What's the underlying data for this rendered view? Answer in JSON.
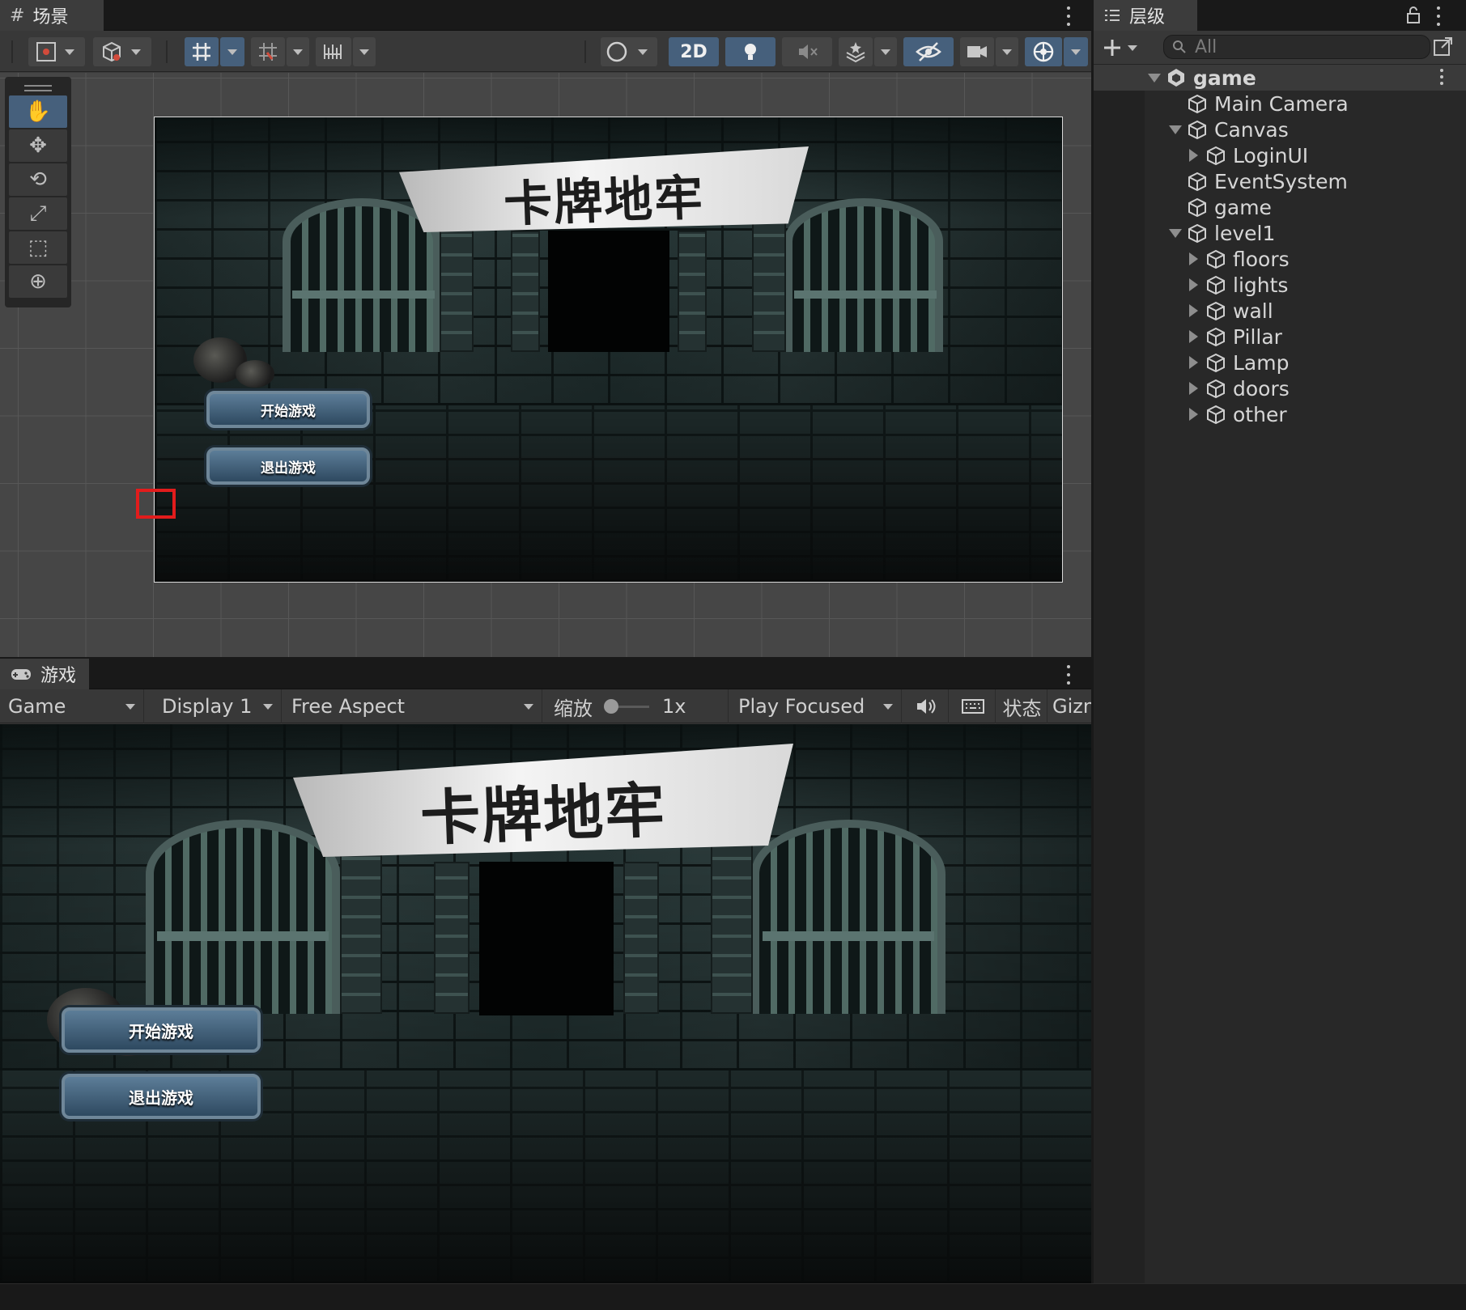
{
  "scene_panel": {
    "tab_label": "场景",
    "tab_icon": "hash-grid-icon",
    "toolbar": {
      "view_2d_label": "2D"
    },
    "tools": [
      "hand-tool-icon",
      "move-tool-icon",
      "rotate-tool-icon",
      "scale-tool-icon",
      "rect-tool-icon",
      "transform-tool-icon"
    ],
    "game_view": {
      "title": "卡牌地牢",
      "start_button": "开始游戏",
      "quit_button": "退出游戏"
    },
    "highlight_color": "#e21c1c"
  },
  "game_panel": {
    "tab_label": "游戏",
    "tab_icon": "gamepad-icon",
    "toolbar": {
      "target": "Game",
      "display": "Display 1",
      "aspect": "Free Aspect",
      "scale_label": "缩放",
      "scale_value": "1x",
      "play_mode": "Play Focused",
      "stats_label": "状态",
      "gizmos_label": "Gizn"
    },
    "game_view": {
      "title": "卡牌地牢",
      "start_button": "开始游戏",
      "quit_button": "退出游戏"
    }
  },
  "hierarchy": {
    "tab_label": "层级",
    "tab_icon": "list-icon",
    "search_placeholder": "All",
    "items": [
      {
        "label": "game",
        "depth": 0,
        "expander": "down",
        "root": true
      },
      {
        "label": "Main Camera",
        "depth": 1,
        "expander": "none"
      },
      {
        "label": "Canvas",
        "depth": 1,
        "expander": "down"
      },
      {
        "label": "LoginUI",
        "depth": 2,
        "expander": "right"
      },
      {
        "label": "EventSystem",
        "depth": 1,
        "expander": "none"
      },
      {
        "label": "game",
        "depth": 1,
        "expander": "none"
      },
      {
        "label": "level1",
        "depth": 1,
        "expander": "down"
      },
      {
        "label": "floors",
        "depth": 2,
        "expander": "right"
      },
      {
        "label": "lights",
        "depth": 2,
        "expander": "right"
      },
      {
        "label": "wall",
        "depth": 2,
        "expander": "right"
      },
      {
        "label": "Pillar",
        "depth": 2,
        "expander": "right"
      },
      {
        "label": "Lamp",
        "depth": 2,
        "expander": "right"
      },
      {
        "label": "doors",
        "depth": 2,
        "expander": "right"
      },
      {
        "label": "other",
        "depth": 2,
        "expander": "right"
      }
    ]
  },
  "colors": {
    "accent_blue": "#46607c",
    "panel_bg": "#383838",
    "tab_bg": "#191919"
  }
}
